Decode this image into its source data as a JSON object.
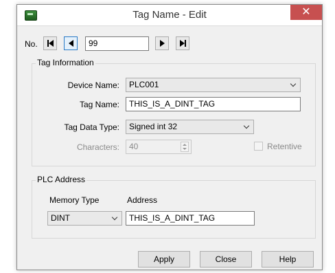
{
  "window": {
    "title": "Tag Name - Edit",
    "close_glyph": "✕"
  },
  "nav": {
    "label": "No.",
    "number_value": "99"
  },
  "tag_info": {
    "title": "Tag Information",
    "device_name_label": "Device Name:",
    "device_name_value": "PLC001",
    "tag_name_label": "Tag Name:",
    "tag_name_value": "THIS_IS_A_DINT_TAG",
    "tag_type_label": "Tag Data Type:",
    "tag_type_value": "Signed int 32",
    "characters_label": "Characters:",
    "characters_value": "40",
    "retentive_label": "Retentive"
  },
  "plc_address": {
    "title": "PLC Address",
    "memory_type_label": "Memory Type",
    "address_label": "Address",
    "memory_type_value": "DINT",
    "address_value": "THIS_IS_A_DINT_TAG"
  },
  "buttons": {
    "apply": "Apply",
    "close": "Close",
    "help": "Help"
  },
  "colors": {
    "close_button": "#c75050",
    "dialog_bg": "#f0f0f0",
    "focus_border": "#2a7ac6"
  },
  "icons": [
    "app-icon",
    "first-record-icon",
    "previous-record-icon",
    "next-record-icon",
    "last-record-icon",
    "chevron-down-icon",
    "spin-up-icon",
    "spin-down-icon"
  ]
}
